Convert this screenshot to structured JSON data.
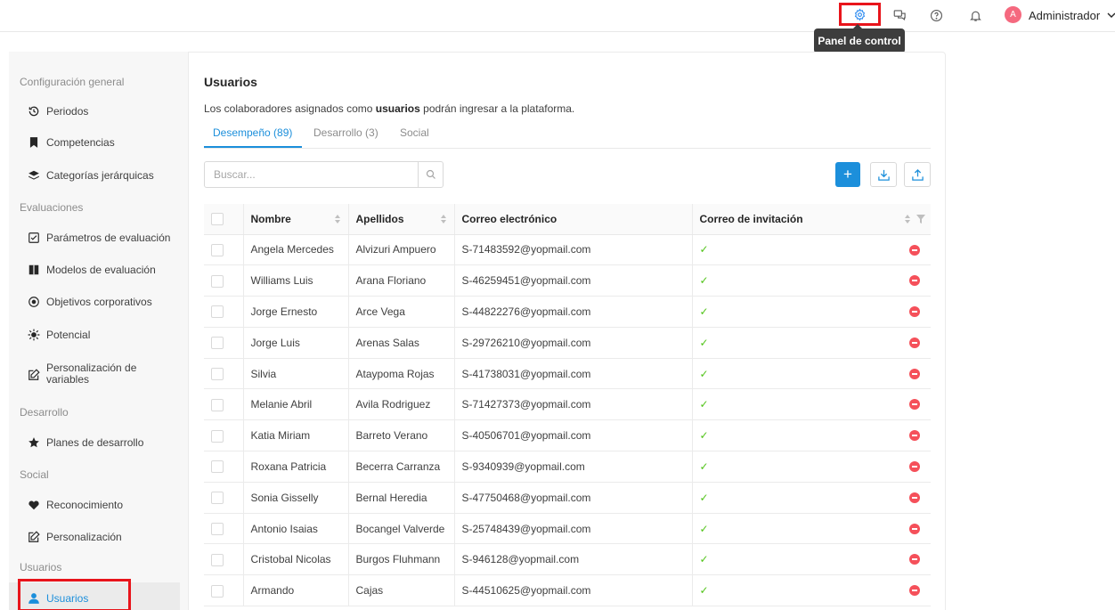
{
  "header": {
    "user_initial": "A",
    "user_name": "Administrador",
    "tooltip": "Panel de control"
  },
  "sidebar": {
    "groups": [
      {
        "label": "Configuración general",
        "items": [
          {
            "label": "Periodos",
            "icon": "history-icon"
          },
          {
            "label": "Competencias",
            "icon": "bookmark-icon"
          },
          {
            "label": "Categorías jerárquicas",
            "icon": "layers-icon"
          }
        ]
      },
      {
        "label": "Evaluaciones",
        "items": [
          {
            "label": "Parámetros de evaluación",
            "icon": "checkbox-icon"
          },
          {
            "label": "Modelos de evaluación",
            "icon": "book-icon"
          },
          {
            "label": "Objetivos corporativos",
            "icon": "target-icon"
          },
          {
            "label": "Potencial",
            "icon": "sun-icon"
          },
          {
            "label": "Personalización de variables",
            "icon": "edit-icon"
          }
        ]
      },
      {
        "label": "Desarrollo",
        "items": [
          {
            "label": "Planes de desarrollo",
            "icon": "star-icon"
          }
        ]
      },
      {
        "label": "Social",
        "items": [
          {
            "label": "Reconocimiento",
            "icon": "heart-icon"
          },
          {
            "label": "Personalización",
            "icon": "edit-icon"
          }
        ]
      },
      {
        "label": "Usuarios",
        "items": [
          {
            "label": "Usuarios",
            "icon": "user-icon",
            "active": true
          }
        ]
      }
    ]
  },
  "main": {
    "title": "Usuarios",
    "description_pre": "Los colaboradores asignados como ",
    "description_bold": "usuarios",
    "description_post": " podrán ingresar a la plataforma.",
    "tabs": [
      {
        "label": "Desempeño (89)",
        "active": true
      },
      {
        "label": "Desarrollo (3)"
      },
      {
        "label": "Social"
      }
    ],
    "search_placeholder": "Buscar...",
    "table": {
      "headers": [
        "Nombre",
        "Apellidos",
        "Correo electrónico",
        "Correo de invitación"
      ],
      "rows": [
        {
          "nombre": "Angela Mercedes",
          "apellidos": "Alvizuri Ampuero",
          "correo": "S-71483592@yopmail.com"
        },
        {
          "nombre": "Williams Luis",
          "apellidos": "Arana Floriano",
          "correo": "S-46259451@yopmail.com"
        },
        {
          "nombre": "Jorge Ernesto",
          "apellidos": "Arce Vega",
          "correo": "S-44822276@yopmail.com"
        },
        {
          "nombre": "Jorge Luis",
          "apellidos": "Arenas Salas",
          "correo": "S-29726210@yopmail.com"
        },
        {
          "nombre": "Silvia",
          "apellidos": "Ataypoma Rojas",
          "correo": "S-41738031@yopmail.com"
        },
        {
          "nombre": "Melanie Abril",
          "apellidos": "Avila Rodriguez",
          "correo": "S-71427373@yopmail.com"
        },
        {
          "nombre": "Katia Miriam",
          "apellidos": "Barreto Verano",
          "correo": "S-40506701@yopmail.com"
        },
        {
          "nombre": "Roxana Patricia",
          "apellidos": "Becerra Carranza",
          "correo": "S-9340939@yopmail.com"
        },
        {
          "nombre": "Sonia Gisselly",
          "apellidos": "Bernal Heredia",
          "correo": "S-47750468@yopmail.com"
        },
        {
          "nombre": "Antonio Isaias",
          "apellidos": "Bocangel Valverde",
          "correo": "S-25748439@yopmail.com"
        },
        {
          "nombre": "Cristobal Nicolas",
          "apellidos": "Burgos Fluhmann",
          "correo": "S-946128@yopmail.com"
        },
        {
          "nombre": "Armando",
          "apellidos": "Cajas",
          "correo": "S-44510625@yopmail.com"
        }
      ]
    }
  },
  "colors": {
    "accent": "#1c8fdb",
    "highlight": "#e8141b",
    "success": "#52c41a",
    "danger": "#f5505a"
  }
}
